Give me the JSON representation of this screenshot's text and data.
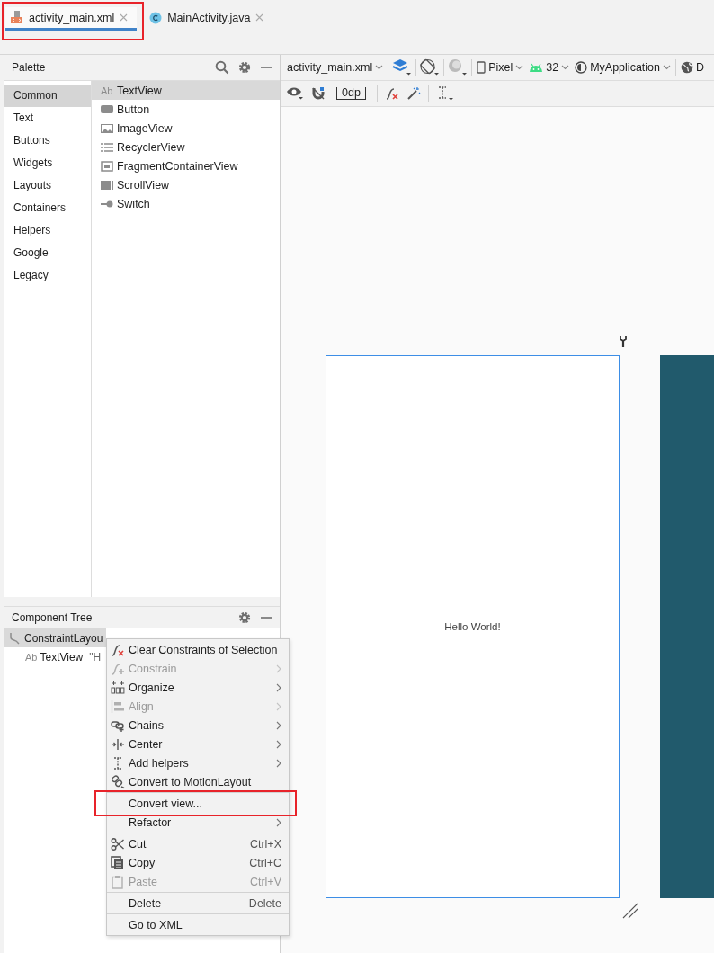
{
  "tabs": [
    {
      "label": "activity_main.xml",
      "kind": "xml",
      "selected": true,
      "highlighted": true
    },
    {
      "label": "MainActivity.java",
      "kind": "java",
      "selected": false,
      "highlighted": false
    }
  ],
  "palette": {
    "title": "Palette",
    "categories": [
      {
        "label": "Common",
        "selected": true
      },
      {
        "label": "Text",
        "selected": false
      },
      {
        "label": "Buttons",
        "selected": false
      },
      {
        "label": "Widgets",
        "selected": false
      },
      {
        "label": "Layouts",
        "selected": false
      },
      {
        "label": "Containers",
        "selected": false
      },
      {
        "label": "Helpers",
        "selected": false
      },
      {
        "label": "Google",
        "selected": false
      },
      {
        "label": "Legacy",
        "selected": false
      }
    ],
    "items": [
      {
        "label": "TextView",
        "kind": "text",
        "badge": "Ab",
        "selected": true
      },
      {
        "label": "Button",
        "kind": "button",
        "selected": false
      },
      {
        "label": "ImageView",
        "kind": "image",
        "selected": false
      },
      {
        "label": "RecyclerView",
        "kind": "list",
        "selected": false
      },
      {
        "label": "FragmentContainerView",
        "kind": "fragment",
        "selected": false
      },
      {
        "label": "ScrollView",
        "kind": "scroll",
        "selected": false
      },
      {
        "label": "Switch",
        "kind": "switch",
        "selected": false
      }
    ]
  },
  "design_toolbar": {
    "file": "activity_main.xml",
    "device": "Pixel",
    "api": "32",
    "theme": "MyApplication",
    "locale": "D",
    "margin": "0dp"
  },
  "component_tree": {
    "title": "Component Tree",
    "nodes": [
      {
        "label": "ConstraintLayou",
        "kind": "layout",
        "selected": true,
        "children": [
          {
            "label": "TextView",
            "badge": "Ab",
            "detail": "\"H",
            "kind": "text",
            "selected": false
          }
        ]
      }
    ]
  },
  "canvas": {
    "text": "Hello World!"
  },
  "context_menu": [
    {
      "kind": "clear",
      "label": "Clear Constraints of Selection",
      "disabled": false,
      "submenu": false,
      "highlighted": false
    },
    {
      "kind": "constrain",
      "label": "Constrain",
      "disabled": true,
      "submenu": true,
      "highlighted": false
    },
    {
      "kind": "organize",
      "label": "Organize",
      "disabled": false,
      "submenu": true,
      "highlighted": false
    },
    {
      "kind": "align",
      "label": "Align",
      "disabled": true,
      "submenu": true,
      "highlighted": false
    },
    {
      "kind": "chains",
      "label": "Chains",
      "disabled": false,
      "submenu": true,
      "highlighted": false
    },
    {
      "kind": "center",
      "label": "Center",
      "disabled": false,
      "submenu": true,
      "highlighted": false
    },
    {
      "kind": "helpers",
      "label": "Add helpers",
      "disabled": false,
      "submenu": true,
      "highlighted": false
    },
    {
      "kind": "motion",
      "label": "Convert to MotionLayout",
      "disabled": false,
      "submenu": false,
      "highlighted": false
    },
    {
      "kind": "separator"
    },
    {
      "kind": "plain",
      "label": "Convert view...",
      "disabled": false,
      "submenu": false,
      "highlighted": true
    },
    {
      "kind": "plain",
      "label": "Refactor",
      "disabled": false,
      "submenu": true,
      "highlighted": false
    },
    {
      "kind": "separator"
    },
    {
      "kind": "cut",
      "label": "Cut",
      "shortcut": "Ctrl+X",
      "disabled": false,
      "submenu": false,
      "highlighted": false
    },
    {
      "kind": "copy",
      "label": "Copy",
      "shortcut": "Ctrl+C",
      "disabled": false,
      "submenu": false,
      "highlighted": false
    },
    {
      "kind": "paste",
      "label": "Paste",
      "shortcut": "Ctrl+V",
      "disabled": true,
      "submenu": false,
      "highlighted": false
    },
    {
      "kind": "separator"
    },
    {
      "kind": "plain",
      "label": "Delete",
      "shortcut": "Delete",
      "disabled": false,
      "submenu": false,
      "highlighted": false
    },
    {
      "kind": "separator"
    },
    {
      "kind": "plain",
      "label": "Go to XML",
      "disabled": false,
      "submenu": false,
      "highlighted": false
    }
  ]
}
